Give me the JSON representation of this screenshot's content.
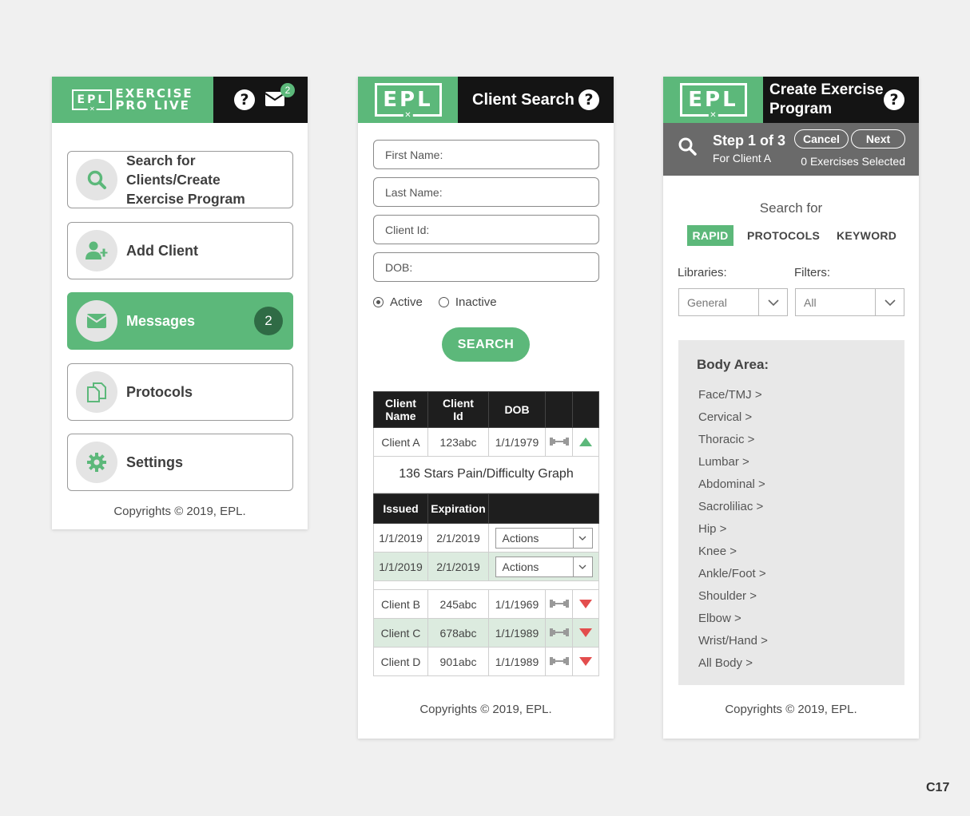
{
  "colors": {
    "brand_green": "#5cb87a",
    "dark": "#141414",
    "step_gray": "#6a6a6a",
    "alert_red": "#e34d4d"
  },
  "screen1": {
    "logo_epl": "EPL",
    "logo_line1": "EXERCISE",
    "logo_line2": "PRO LIVE",
    "mail_badge": "2",
    "menu": [
      {
        "label_line1": "Search for Clients/Create",
        "label_line2": "Exercise Program",
        "icon": "search-icon"
      },
      {
        "label": "Add Client",
        "icon": "add-user-icon"
      },
      {
        "label": "Messages",
        "icon": "mail-icon",
        "badge": "2"
      },
      {
        "label": "Protocols",
        "icon": "copy-icon"
      },
      {
        "label": "Settings",
        "icon": "gear-icon"
      }
    ],
    "copyright": "Copyrights © 2019, EPL."
  },
  "screen2": {
    "logo": "EPL",
    "title": "Client Search",
    "fields": {
      "first_name": "First Name:",
      "last_name": "Last Name:",
      "client_id": "Client Id:",
      "dob": "DOB:"
    },
    "radio_active": "Active",
    "radio_inactive": "Inactive",
    "search_button": "SEARCH",
    "table_headers": {
      "name_1": "Client",
      "name_2": "Name",
      "id_1": "Client",
      "id_2": "Id",
      "dob": "DOB"
    },
    "client_a": {
      "name": "Client A",
      "id": "123abc",
      "dob": "1/1/1979"
    },
    "detail_title": "136 Stars  Pain/Difficulty Graph",
    "detail_headers": {
      "issued": "Issued",
      "expiration": "Expiration"
    },
    "programs": [
      {
        "issued": "1/1/2019",
        "expiration": "2/1/2019",
        "action": "Actions"
      },
      {
        "issued": "1/1/2019",
        "expiration": "2/1/2019",
        "action": "Actions"
      }
    ],
    "clients": [
      {
        "name": "Client B",
        "id": "245abc",
        "dob": "1/1/1969"
      },
      {
        "name": "Client C",
        "id": "678abc",
        "dob": "1/1/1989"
      },
      {
        "name": "Client D",
        "id": "901abc",
        "dob": "1/1/1989"
      }
    ],
    "copyright": "Copyrights © 2019, EPL."
  },
  "screen3": {
    "logo": "EPL",
    "title_line1": "Create Exercise",
    "title_line2": "Program",
    "step": "Step 1 of 3",
    "for_client": "For Client A",
    "cancel": "Cancel",
    "next": "Next",
    "selected": "0 Exercises Selected",
    "search_for": "Search for",
    "tabs": {
      "rapid": "RAPID",
      "protocols": "PROTOCOLS",
      "keyword": "KEYWORD"
    },
    "libraries_label": "Libraries:",
    "filters_label": "Filters:",
    "libraries_value": "General",
    "filters_value": "All",
    "body_area_title": "Body Area:",
    "body_areas": [
      "Face/TMJ >",
      "Cervical >",
      "Thoracic >",
      "Lumbar >",
      "Abdominal >",
      "Sacroliliac >",
      "Hip >",
      "Knee >",
      "Ankle/Foot >",
      "Shoulder >",
      "Elbow >",
      "Wrist/Hand >",
      "All Body >"
    ],
    "copyright": "Copyrights © 2019, EPL."
  },
  "corner_tag": "C17"
}
